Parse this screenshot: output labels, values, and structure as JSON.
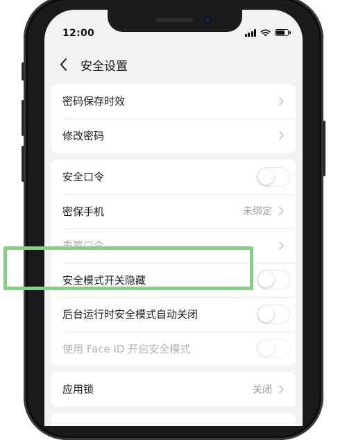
{
  "status_bar": {
    "time": "12:00",
    "signal_icon": "signal-bars-icon",
    "wifi_icon": "wifi-icon",
    "battery_icon": "battery-icon",
    "battery_level": 0.8
  },
  "nav": {
    "back_icon": "chevron-left-icon",
    "title": "安全设置"
  },
  "groups": [
    {
      "items": [
        {
          "label": "密码保存时效",
          "control": "chevron"
        },
        {
          "label": "修改密码",
          "control": "chevron"
        }
      ]
    },
    {
      "items": [
        {
          "label": "安全口令",
          "control": "toggle",
          "on": false
        },
        {
          "label": "密保手机",
          "value": "未绑定",
          "control": "chevron"
        },
        {
          "label": "重置口令",
          "control": "chevron",
          "disabled": true
        },
        {
          "label": "安全模式开关隐藏",
          "control": "toggle",
          "on": false,
          "highlighted": true
        },
        {
          "label": "后台运行时安全模式自动关闭",
          "control": "toggle",
          "on": false
        },
        {
          "label": "使用 Face ID 开启安全模式",
          "control": "toggle",
          "on": false,
          "disabled": true
        }
      ]
    },
    {
      "items": [
        {
          "label": "应用锁",
          "value": "关闭",
          "control": "chevron"
        }
      ]
    }
  ],
  "colors": {
    "highlight_border": "#86d085",
    "background": "#f2f2f2",
    "text": "#1a1a1a",
    "disabled_text": "#b3b3b3",
    "secondary_text": "#999999"
  }
}
